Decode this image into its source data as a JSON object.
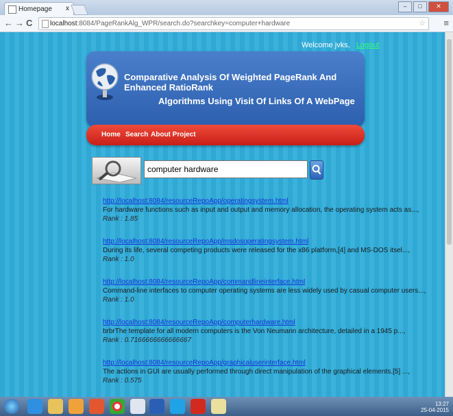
{
  "browser": {
    "tab_title": "Homepage",
    "tab_close": "x",
    "url_host": "localhost",
    "url_rest": ":8084/PageRankAlg_WPR/search.do?searchkey=computer+hardware"
  },
  "header": {
    "welcome": "Welcome jvks,",
    "logout": "Logout"
  },
  "banner": {
    "title_line1": "Comparative Analysis Of Weighted PageRank And Enhanced RatioRank",
    "title_line2": "Algorithms Using Visit Of Links Of A WebPage"
  },
  "nav": {
    "home": "Home",
    "search": "Search",
    "about": "About Project"
  },
  "search": {
    "value": "computer hardware"
  },
  "results": [
    {
      "url": "http://localhost:8084/resourceRepoApp/operatingsystem.html",
      "desc": "For hardware functions such as input and output and memory allocation, the operating system acts as...,",
      "rank": "Rank : 1.85"
    },
    {
      "url": "http://localhost:8084/resourceRepoApp/msdosoperatingsystem.html",
      "desc": "During its life, several competing products were released for the x86 platform,[4] and MS-DOS itsel...,",
      "rank": "Rank : 1.0"
    },
    {
      "url": "http://localhost:8084/resourceRepoApp/commandlineinterface.html",
      "desc": "Command-line interfaces to computer operating systems are less widely used by casual computer users...,",
      "rank": "Rank : 1.0"
    },
    {
      "url": "http://localhost:8084/resourceRepoApp/computerhardware.html",
      "desc": "brbrThe template for all modern computers is the Von Neumann architecture, detailed in a 1945 p...,",
      "rank": "Rank : 0.7166666666666667"
    },
    {
      "url": "http://localhost:8084/resourceRepoApp/graphicaluserinterface.html",
      "desc": "The actions in GUI are usually performed through direct manipulation of the graphical elements.[5] ...,",
      "rank": "Rank : 0.575"
    }
  ],
  "tray": {
    "time": "13:27",
    "date": "25-04-2015"
  }
}
